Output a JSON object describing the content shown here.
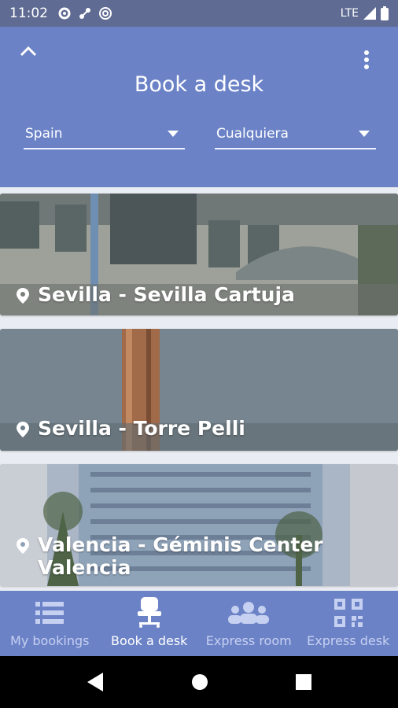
{
  "status": {
    "time": "11:02",
    "network": "LTE"
  },
  "header": {
    "title": "Book a desk"
  },
  "filters": {
    "country": "Spain",
    "type": "Cualquiera"
  },
  "cards": [
    {
      "label": "Sevilla - Sevilla Cartuja"
    },
    {
      "label": "Sevilla - Torre Pelli"
    },
    {
      "label_line1": "Valencia - Géminis Center",
      "label_line2": "Valencia"
    }
  ],
  "nav": {
    "my_bookings": "My bookings",
    "book_desk": "Book a desk",
    "express_room": "Express room",
    "express_desk": "Express desk"
  },
  "colors": {
    "primary": "#6b82c7",
    "status": "#5f6b92",
    "inactive": "#c6d0f0"
  }
}
